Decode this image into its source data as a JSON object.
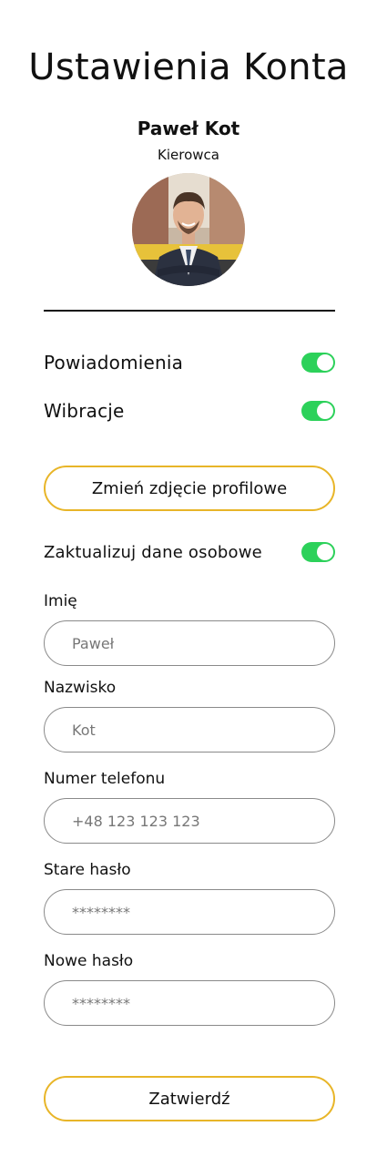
{
  "page": {
    "title": "Ustawienia Konta"
  },
  "profile": {
    "name": "Paweł Kot",
    "role": "Kierowca"
  },
  "settings": {
    "notifications": {
      "label": "Powiadomienia",
      "enabled": true
    },
    "vibrations": {
      "label": "Wibracje",
      "enabled": true
    }
  },
  "actions": {
    "change_photo_label": "Zmień zdjęcie profilowe",
    "submit_label": "Zatwierdź"
  },
  "personal_data": {
    "toggle_label": "Zaktualizuj dane osobowe",
    "toggle_enabled": true,
    "first_name": {
      "label": "Imię",
      "placeholder": "Paweł",
      "value": ""
    },
    "last_name": {
      "label": "Nazwisko",
      "placeholder": "Kot",
      "value": ""
    },
    "phone": {
      "label": "Numer telefonu",
      "placeholder": "+48 123 123 123",
      "value": ""
    },
    "old_password": {
      "label": "Stare hasło",
      "placeholder": "********",
      "value": ""
    },
    "new_password": {
      "label": "Nowe hasło",
      "placeholder": "********",
      "value": ""
    }
  },
  "colors": {
    "toggle_on": "#2cd15a",
    "button_border": "#e8b528",
    "field_border": "#8a8a8a"
  }
}
